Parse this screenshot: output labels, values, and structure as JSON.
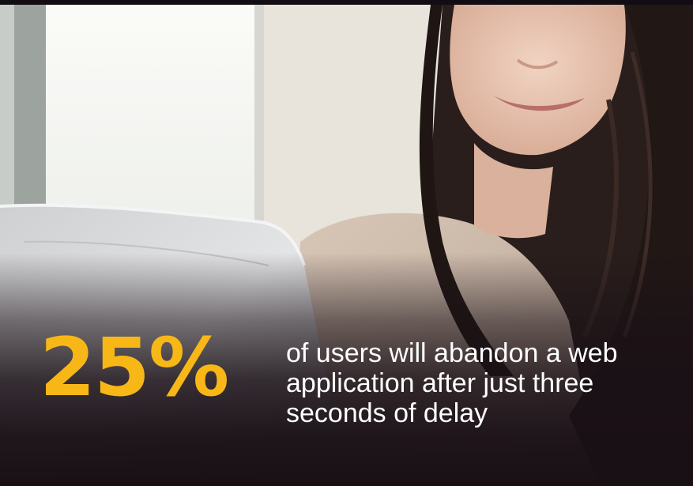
{
  "slide": {
    "stat_value": "25%",
    "caption_lines": [
      "of users will abandon a web",
      "application after just three",
      "seconds of delay"
    ],
    "colors": {
      "stat": "#f7b716",
      "caption": "#ffffff",
      "background": "#1a1216"
    },
    "background_image": "woman-using-laptop-photo"
  }
}
